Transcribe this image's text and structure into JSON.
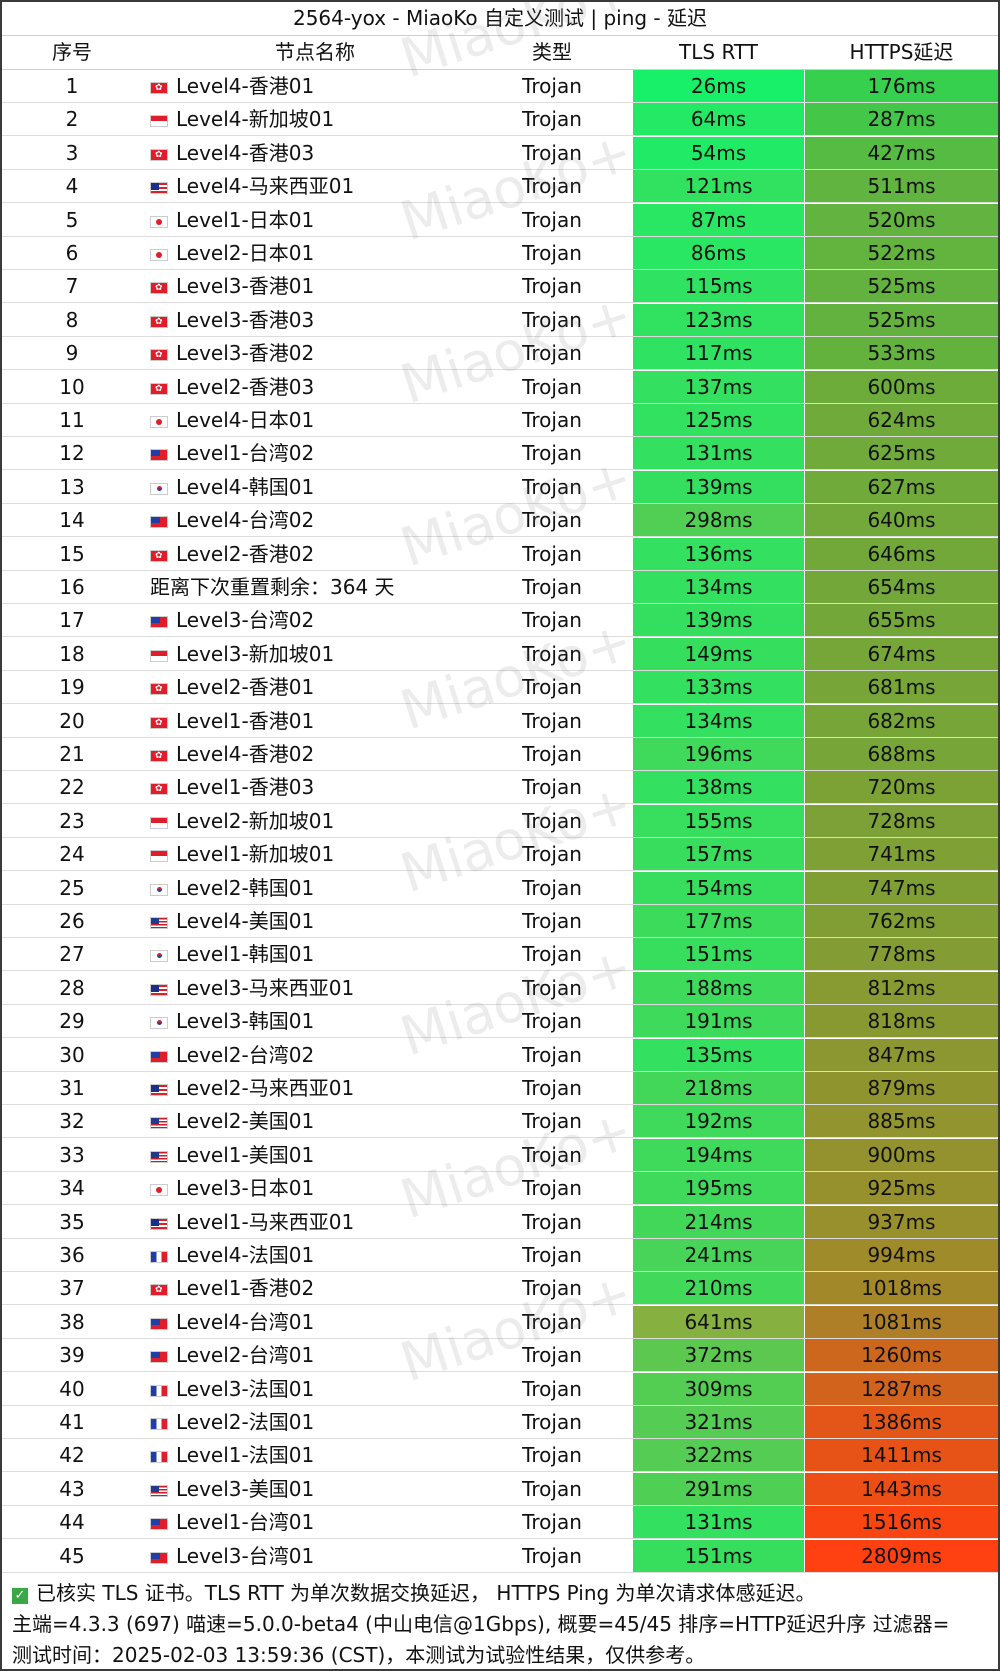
{
  "title": "2564-yox - MiaoKo 自定义测试 | ping - 延迟",
  "headers": {
    "idx": "序号",
    "name": "节点名称",
    "type": "类型",
    "tls": "TLS RTT",
    "https": "HTTPS延迟"
  },
  "watermark": "MiaoKo+",
  "rows": [
    {
      "idx": "1",
      "flag": "hk",
      "name": "Level4-香港01",
      "type": "Trojan",
      "tls": "26ms",
      "https": "176ms"
    },
    {
      "idx": "2",
      "flag": "sg",
      "name": "Level4-新加坡01",
      "type": "Trojan",
      "tls": "64ms",
      "https": "287ms"
    },
    {
      "idx": "3",
      "flag": "hk",
      "name": "Level4-香港03",
      "type": "Trojan",
      "tls": "54ms",
      "https": "427ms"
    },
    {
      "idx": "4",
      "flag": "my",
      "name": "Level4-马来西亚01",
      "type": "Trojan",
      "tls": "121ms",
      "https": "511ms"
    },
    {
      "idx": "5",
      "flag": "jp",
      "name": "Level1-日本01",
      "type": "Trojan",
      "tls": "87ms",
      "https": "520ms"
    },
    {
      "idx": "6",
      "flag": "jp",
      "name": "Level2-日本01",
      "type": "Trojan",
      "tls": "86ms",
      "https": "522ms"
    },
    {
      "idx": "7",
      "flag": "hk",
      "name": "Level3-香港01",
      "type": "Trojan",
      "tls": "115ms",
      "https": "525ms"
    },
    {
      "idx": "8",
      "flag": "hk",
      "name": "Level3-香港03",
      "type": "Trojan",
      "tls": "123ms",
      "https": "525ms"
    },
    {
      "idx": "9",
      "flag": "hk",
      "name": "Level3-香港02",
      "type": "Trojan",
      "tls": "117ms",
      "https": "533ms"
    },
    {
      "idx": "10",
      "flag": "hk",
      "name": "Level2-香港03",
      "type": "Trojan",
      "tls": "137ms",
      "https": "600ms"
    },
    {
      "idx": "11",
      "flag": "jp",
      "name": "Level4-日本01",
      "type": "Trojan",
      "tls": "125ms",
      "https": "624ms"
    },
    {
      "idx": "12",
      "flag": "tw",
      "name": "Level1-台湾02",
      "type": "Trojan",
      "tls": "131ms",
      "https": "625ms"
    },
    {
      "idx": "13",
      "flag": "kr",
      "name": "Level4-韩国01",
      "type": "Trojan",
      "tls": "139ms",
      "https": "627ms"
    },
    {
      "idx": "14",
      "flag": "tw",
      "name": "Level4-台湾02",
      "type": "Trojan",
      "tls": "298ms",
      "https": "640ms"
    },
    {
      "idx": "15",
      "flag": "hk",
      "name": "Level2-香港02",
      "type": "Trojan",
      "tls": "136ms",
      "https": "646ms"
    },
    {
      "idx": "16",
      "flag": "",
      "name": "距离下次重置剩余：364 天",
      "type": "Trojan",
      "tls": "134ms",
      "https": "654ms"
    },
    {
      "idx": "17",
      "flag": "tw",
      "name": "Level3-台湾02",
      "type": "Trojan",
      "tls": "139ms",
      "https": "655ms"
    },
    {
      "idx": "18",
      "flag": "sg",
      "name": "Level3-新加坡01",
      "type": "Trojan",
      "tls": "149ms",
      "https": "674ms"
    },
    {
      "idx": "19",
      "flag": "hk",
      "name": "Level2-香港01",
      "type": "Trojan",
      "tls": "133ms",
      "https": "681ms"
    },
    {
      "idx": "20",
      "flag": "hk",
      "name": "Level1-香港01",
      "type": "Trojan",
      "tls": "134ms",
      "https": "682ms"
    },
    {
      "idx": "21",
      "flag": "hk",
      "name": "Level4-香港02",
      "type": "Trojan",
      "tls": "196ms",
      "https": "688ms"
    },
    {
      "idx": "22",
      "flag": "hk",
      "name": "Level1-香港03",
      "type": "Trojan",
      "tls": "138ms",
      "https": "720ms"
    },
    {
      "idx": "23",
      "flag": "sg",
      "name": "Level2-新加坡01",
      "type": "Trojan",
      "tls": "155ms",
      "https": "728ms"
    },
    {
      "idx": "24",
      "flag": "sg",
      "name": "Level1-新加坡01",
      "type": "Trojan",
      "tls": "157ms",
      "https": "741ms"
    },
    {
      "idx": "25",
      "flag": "kr",
      "name": "Level2-韩国01",
      "type": "Trojan",
      "tls": "154ms",
      "https": "747ms"
    },
    {
      "idx": "26",
      "flag": "us",
      "name": "Level4-美国01",
      "type": "Trojan",
      "tls": "177ms",
      "https": "762ms"
    },
    {
      "idx": "27",
      "flag": "kr",
      "name": "Level1-韩国01",
      "type": "Trojan",
      "tls": "151ms",
      "https": "778ms"
    },
    {
      "idx": "28",
      "flag": "my",
      "name": "Level3-马来西亚01",
      "type": "Trojan",
      "tls": "188ms",
      "https": "812ms"
    },
    {
      "idx": "29",
      "flag": "kr",
      "name": "Level3-韩国01",
      "type": "Trojan",
      "tls": "191ms",
      "https": "818ms"
    },
    {
      "idx": "30",
      "flag": "tw",
      "name": "Level2-台湾02",
      "type": "Trojan",
      "tls": "135ms",
      "https": "847ms"
    },
    {
      "idx": "31",
      "flag": "my",
      "name": "Level2-马来西亚01",
      "type": "Trojan",
      "tls": "218ms",
      "https": "879ms"
    },
    {
      "idx": "32",
      "flag": "us",
      "name": "Level2-美国01",
      "type": "Trojan",
      "tls": "192ms",
      "https": "885ms"
    },
    {
      "idx": "33",
      "flag": "us",
      "name": "Level1-美国01",
      "type": "Trojan",
      "tls": "194ms",
      "https": "900ms"
    },
    {
      "idx": "34",
      "flag": "jp",
      "name": "Level3-日本01",
      "type": "Trojan",
      "tls": "195ms",
      "https": "925ms"
    },
    {
      "idx": "35",
      "flag": "my",
      "name": "Level1-马来西亚01",
      "type": "Trojan",
      "tls": "214ms",
      "https": "937ms"
    },
    {
      "idx": "36",
      "flag": "fr",
      "name": "Level4-法国01",
      "type": "Trojan",
      "tls": "241ms",
      "https": "994ms"
    },
    {
      "idx": "37",
      "flag": "hk",
      "name": "Level1-香港02",
      "type": "Trojan",
      "tls": "210ms",
      "https": "1018ms"
    },
    {
      "idx": "38",
      "flag": "tw",
      "name": "Level4-台湾01",
      "type": "Trojan",
      "tls": "641ms",
      "https": "1081ms"
    },
    {
      "idx": "39",
      "flag": "tw",
      "name": "Level2-台湾01",
      "type": "Trojan",
      "tls": "372ms",
      "https": "1260ms"
    },
    {
      "idx": "40",
      "flag": "fr",
      "name": "Level3-法国01",
      "type": "Trojan",
      "tls": "309ms",
      "https": "1287ms"
    },
    {
      "idx": "41",
      "flag": "fr",
      "name": "Level2-法国01",
      "type": "Trojan",
      "tls": "321ms",
      "https": "1386ms"
    },
    {
      "idx": "42",
      "flag": "fr",
      "name": "Level1-法国01",
      "type": "Trojan",
      "tls": "322ms",
      "https": "1411ms"
    },
    {
      "idx": "43",
      "flag": "us",
      "name": "Level3-美国01",
      "type": "Trojan",
      "tls": "291ms",
      "https": "1443ms"
    },
    {
      "idx": "44",
      "flag": "tw",
      "name": "Level1-台湾01",
      "type": "Trojan",
      "tls": "131ms",
      "https": "1516ms"
    },
    {
      "idx": "45",
      "flag": "tw",
      "name": "Level3-台湾01",
      "type": "Trojan",
      "tls": "151ms",
      "https": "2809ms"
    }
  ],
  "colors": {
    "tls_fast": "#18f06a",
    "tls_slow": "#86b040",
    "https_fast": "#36d04e",
    "https_mid": "#a08a2a",
    "https_slow": "#ff4010",
    "border": "#3a3a3a"
  },
  "footer": {
    "line1": "已核实 TLS 证书。TLS RTT 为单次数据交换延迟， HTTPS Ping 为单次请求体感延迟。",
    "line2": "主端=4.3.3 (697) 喵速=5.0.0-beta4 (中山电信@1Gbps), 概要=45/45 排序=HTTP延迟升序 过滤器=",
    "line3": "测试时间：2025-02-03 13:59:36 (CST)，本测试为试验性结果，仅供参考。"
  }
}
